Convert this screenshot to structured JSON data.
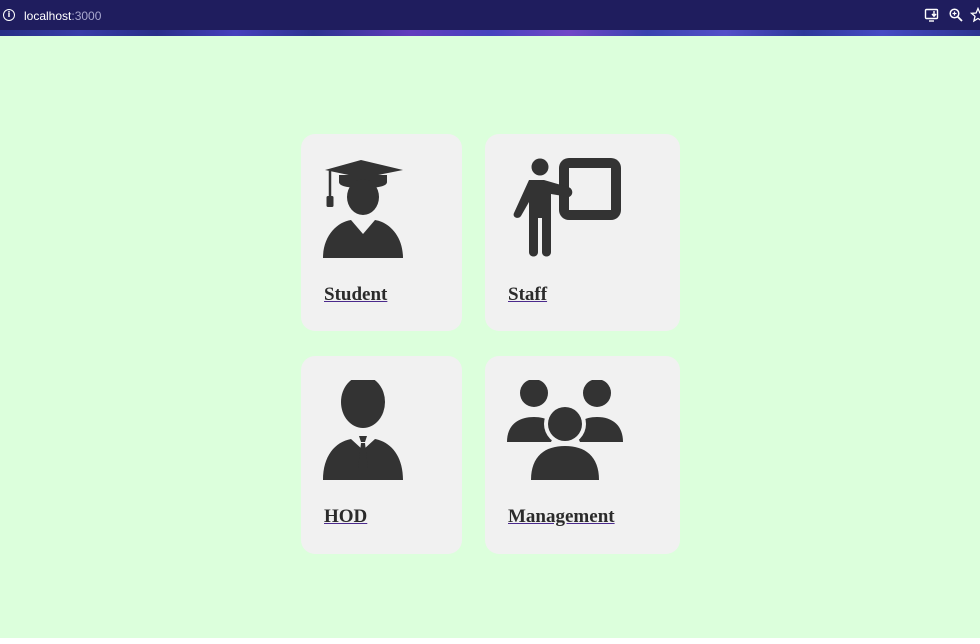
{
  "browser": {
    "url_host": "localhost",
    "url_port": ":3000",
    "icons": [
      "info-icon",
      "install-app-icon",
      "zoom-icon",
      "bookmark-star-icon"
    ]
  },
  "page": {
    "background_color": "#dcffdc",
    "card_color": "#f1f1f1",
    "icon_color": "#333333"
  },
  "roles": [
    {
      "label": "Student",
      "icon": "graduate-icon"
    },
    {
      "label": "Staff",
      "icon": "teacher-board-icon"
    },
    {
      "label": "HOD",
      "icon": "businessman-icon"
    },
    {
      "label": "Management",
      "icon": "group-icon"
    }
  ]
}
